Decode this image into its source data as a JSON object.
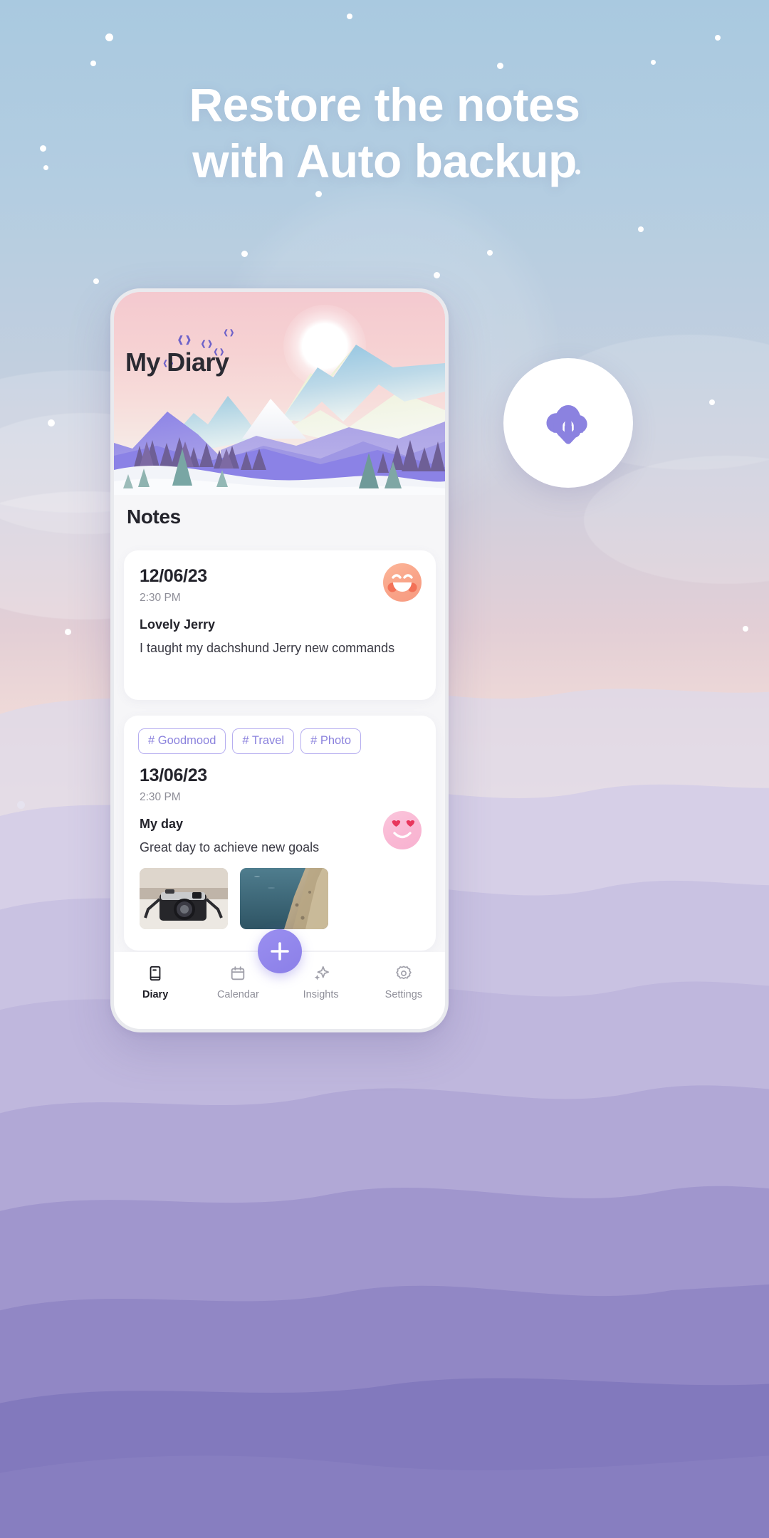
{
  "promo": {
    "headline_line1": "Restore the notes",
    "headline_line2": "with Auto backup",
    "badge_icon": "cloud-download-icon"
  },
  "app": {
    "hero_title": "My Diary",
    "section_title": "Notes",
    "notes": [
      {
        "date": "12/06/23",
        "time": "2:30 PM",
        "title": "Lovely Jerry",
        "body": "I taught my dachshund Jerry new commands",
        "mood_icon": "laughing-face-emoji",
        "tags": [],
        "photos": []
      },
      {
        "date": "13/06/23",
        "time": "2:30 PM",
        "title": "My day",
        "body": "Great day to achieve new goals",
        "mood_icon": "heart-eyes-face-emoji",
        "tags": [
          "# Goodmood",
          "# Travel",
          "# Photo"
        ],
        "photos": [
          "camera-photo-thumbnail",
          "sea-cliff-photo-thumbnail"
        ]
      }
    ],
    "fab_label": "+",
    "fab_icon": "plus-icon",
    "tabs": [
      {
        "label": "Diary",
        "icon": "book-icon",
        "active": true
      },
      {
        "label": "Calendar",
        "icon": "calendar-icon",
        "active": false
      },
      {
        "label": "Insights",
        "icon": "sparkle-icon",
        "active": false
      },
      {
        "label": "Settings",
        "icon": "gear-icon",
        "active": false
      }
    ]
  },
  "colors": {
    "accent_purple": "#8b7fe8",
    "tag_border": "#b6aef0",
    "tag_text": "#8b82dd",
    "headline_text": "#ffffff",
    "card_bg": "#ffffff"
  }
}
